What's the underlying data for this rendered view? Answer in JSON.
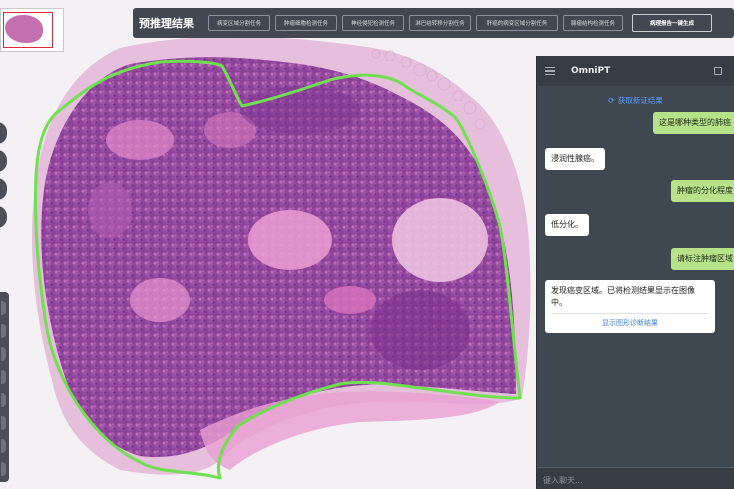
{
  "toolbar": {
    "title": "预推理结果",
    "buttons": [
      "病变区域分割任务",
      "肿瘤细胞检测任务",
      "神经侵犯检测任务",
      "淋巴结转移分割任务",
      "肝癌的病变区域分割任务",
      "腺瘤结构检测任务"
    ],
    "report_button": "病理报告一键生成"
  },
  "chat": {
    "app_name": "OmniPT",
    "refresh_label": "获取新证结果",
    "messages": [
      {
        "role": "user",
        "text": "这是哪种类型的肺癌"
      },
      {
        "role": "assistant",
        "text": "浸润性腺癌。"
      },
      {
        "role": "user",
        "text": "肿瘤的分化程度"
      },
      {
        "role": "assistant",
        "text": "低分化。"
      },
      {
        "role": "user",
        "text": "请标注肿瘤区域"
      },
      {
        "role": "assistant",
        "text": "发现癌变区域。已将检测结果显示在图像中。",
        "link": "显示图形诊断结果"
      }
    ],
    "input_placeholder": "键入聊天..."
  },
  "colors": {
    "annotation": "#6fe050",
    "tissue_pink": "#e08ac6",
    "tissue_purple": "#8a3d95",
    "user_bubble": "#b8e28a",
    "panel_bg": "#3f4750"
  },
  "icons": [
    "menu-icon",
    "copy-icon",
    "refresh-icon"
  ]
}
